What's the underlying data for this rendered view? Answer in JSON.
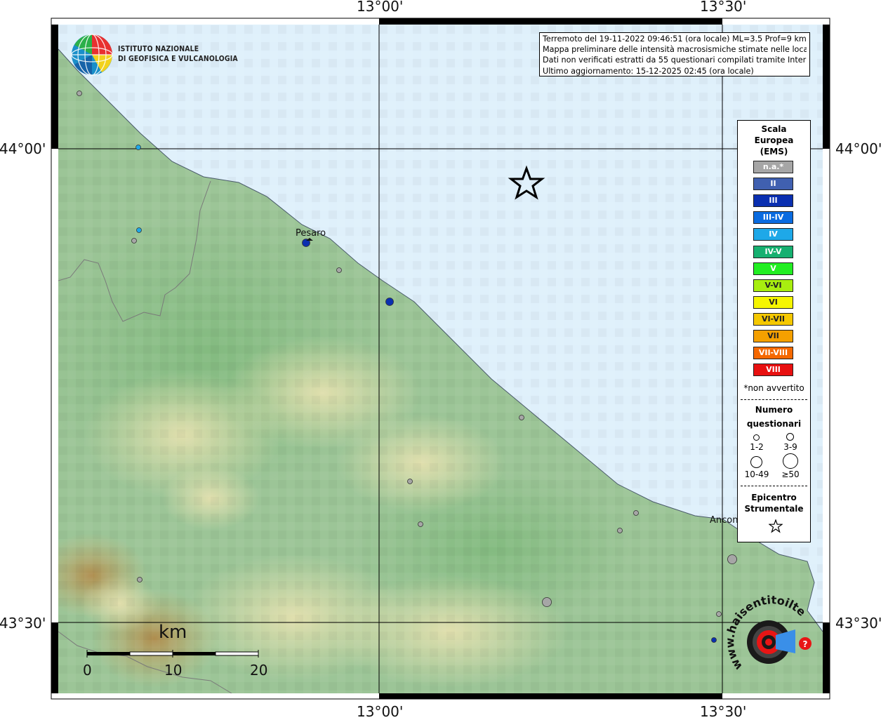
{
  "coords": {
    "top": [
      "13°00'",
      "13°30'"
    ],
    "bottom": [
      "13°00'",
      "13°30'"
    ],
    "left": [
      "44°00'",
      "43°30'"
    ],
    "right": [
      "44°00'",
      "43°30'"
    ]
  },
  "info": {
    "line1": "Terremoto del 19-11-2022 09:46:51 (ora locale) ML=3.5 Prof=9 km",
    "line2": "Mappa preliminare delle intensità macrosismiche stimate nelle località",
    "line3": "Dati non verificati estratti da 55 questionari compilati tramite Internet.",
    "line4": "Ultimo aggiornamento: 15-12-2025 02:45 (ora locale)"
  },
  "institute": {
    "line1": "ISTITUTO NAZIONALE",
    "line2": "DI GEOFISICA E VULCANOLOGIA"
  },
  "cities": {
    "pesaro": "Pesaro",
    "ancona": "Ancona"
  },
  "scale_bar": {
    "unit": "km",
    "labels": [
      "0",
      "10",
      "20"
    ]
  },
  "legend": {
    "title_lines": [
      "Scala",
      "Europea",
      "(EMS)"
    ],
    "items": [
      {
        "label": "n.a.*",
        "color": "#a6a6a6"
      },
      {
        "label": "II",
        "color": "#4060b0"
      },
      {
        "label": "III",
        "color": "#0a2fb0"
      },
      {
        "label": "III-IV",
        "color": "#0a6be0"
      },
      {
        "label": "IV",
        "color": "#1ea8e8"
      },
      {
        "label": "IV-V",
        "color": "#16b070"
      },
      {
        "label": "V",
        "color": "#22ee22"
      },
      {
        "label": "V-VI",
        "color": "#a8ee10"
      },
      {
        "label": "VI",
        "color": "#f5f500"
      },
      {
        "label": "VI-VII",
        "color": "#f5c800"
      },
      {
        "label": "VII",
        "color": "#f5a000"
      },
      {
        "label": "VII-VIII",
        "color": "#f56800"
      },
      {
        "label": "VIII",
        "color": "#e81010"
      }
    ],
    "note": "*non avvertito",
    "count_title_lines": [
      "Numero",
      "questionari"
    ],
    "count_sizes": [
      "1-2",
      "3-9",
      "10-49",
      "≥50"
    ],
    "epicenter_title_lines": [
      "Epicentro",
      "Strumentale"
    ]
  },
  "logo_hsit": {
    "text": "haisentitoilterremoto.it",
    "url_text": "www."
  },
  "colors": {
    "sea": "#dff0fb",
    "land": "#9cc597",
    "frame": "#000000"
  },
  "points": [
    {
      "kind": "na",
      "count": "1-2"
    },
    {
      "kind": "IV",
      "count": "1-2"
    },
    {
      "kind": "IV",
      "count": "1-2"
    },
    {
      "kind": "na",
      "count": "1-2"
    },
    {
      "kind": "III",
      "count": "3-9"
    },
    {
      "kind": "na",
      "count": "1-2"
    },
    {
      "kind": "III",
      "count": "3-9"
    },
    {
      "kind": "na",
      "count": "1-2"
    },
    {
      "kind": "na",
      "count": "1-2"
    },
    {
      "kind": "na",
      "count": "1-2"
    },
    {
      "kind": "na",
      "count": "1-2"
    },
    {
      "kind": "na",
      "count": "1-2"
    },
    {
      "kind": "na",
      "count": "3-9"
    },
    {
      "kind": "na",
      "count": "3-9"
    },
    {
      "kind": "na",
      "count": "1-2"
    },
    {
      "kind": "III",
      "count": "1-2"
    },
    {
      "kind": "na",
      "count": "1-2"
    }
  ]
}
